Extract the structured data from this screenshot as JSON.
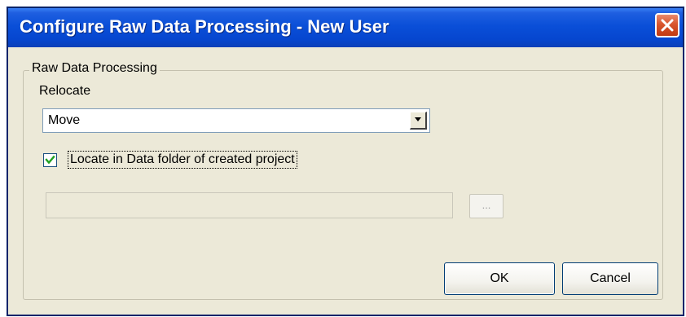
{
  "window": {
    "title": "Configure Raw Data Processing - New User"
  },
  "groupbox": {
    "label": "Raw Data Processing"
  },
  "relocate": {
    "label": "Relocate",
    "selected_value": "Move"
  },
  "locate_checkbox": {
    "label": "Locate in Data folder of created project",
    "checked": true
  },
  "path_field": {
    "value": ""
  },
  "browse_button": {
    "label": "..."
  },
  "buttons": {
    "ok_label": "OK",
    "cancel_label": "Cancel"
  },
  "icons": {
    "close": "close-icon",
    "dropdown": "chevron-down-icon",
    "checkmark": "checkmark-icon"
  },
  "colors": {
    "titlebar": "#0a4fd8",
    "close_button": "#d9552d",
    "dialog_background": "#ece9d8"
  }
}
